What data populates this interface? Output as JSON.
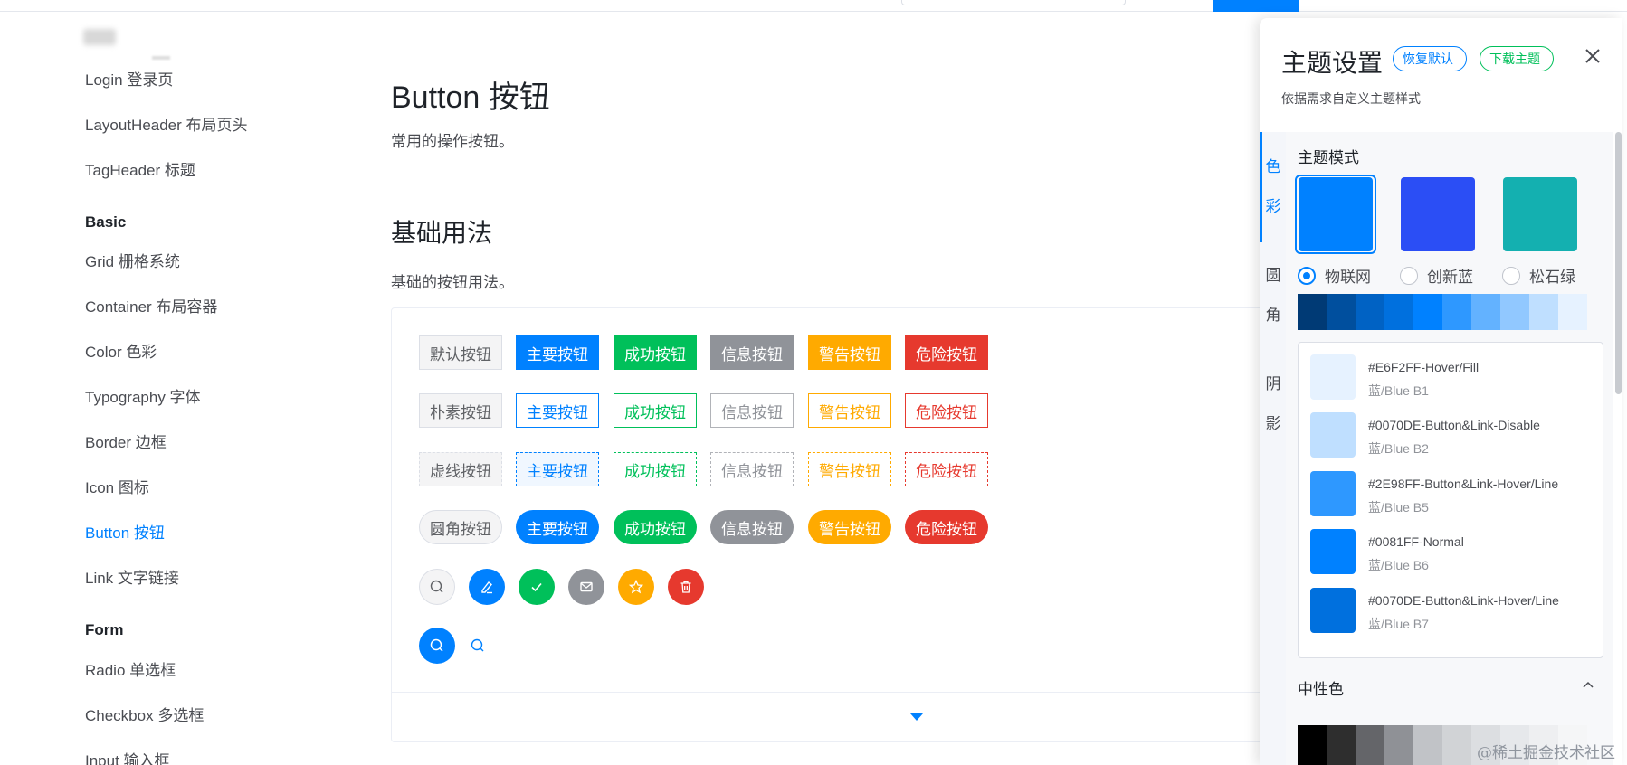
{
  "sidebar": {
    "items_top": [
      {
        "label": "Login 登录页"
      },
      {
        "label": "LayoutHeader 布局页头"
      },
      {
        "label": "TagHeader 标题"
      }
    ],
    "group_basic": "Basic",
    "items_basic": [
      {
        "label": "Grid 栅格系统"
      },
      {
        "label": "Container 布局容器"
      },
      {
        "label": "Color 色彩"
      },
      {
        "label": "Typography 字体"
      },
      {
        "label": "Border 边框"
      },
      {
        "label": "Icon 图标"
      },
      {
        "label": "Button 按钮",
        "active": true
      },
      {
        "label": "Link 文字链接"
      }
    ],
    "group_form": "Form",
    "items_form": [
      {
        "label": "Radio 单选框"
      },
      {
        "label": "Checkbox 多选框"
      },
      {
        "label": "Input 输入框"
      }
    ]
  },
  "main": {
    "title": "Button 按钮",
    "description": "常用的操作按钮。",
    "section_title": "基础用法",
    "section_description": "基础的按钮用法。",
    "rows": {
      "solid": [
        "默认按钮",
        "主要按钮",
        "成功按钮",
        "信息按钮",
        "警告按钮",
        "危险按钮"
      ],
      "plain": [
        "朴素按钮",
        "主要按钮",
        "成功按钮",
        "信息按钮",
        "警告按钮",
        "危险按钮"
      ],
      "dashed": [
        "虚线按钮",
        "主要按钮",
        "成功按钮",
        "信息按钮",
        "警告按钮",
        "危险按钮"
      ],
      "round": [
        "圆角按钮",
        "主要按钮",
        "成功按钮",
        "信息按钮",
        "警告按钮",
        "危险按钮"
      ]
    },
    "icon_buttons": [
      "search-icon",
      "edit-icon",
      "check-icon",
      "mail-icon",
      "star-icon",
      "delete-icon"
    ],
    "icon_buttons_row2": [
      "search-icon",
      "search-icon"
    ]
  },
  "theme_panel": {
    "title": "主题设置",
    "reset_label": "恢复默认",
    "download_label": "下载主题",
    "subtitle": "依据需求自定义主题样式",
    "tabs": [
      {
        "chars": [
          "色",
          "彩"
        ],
        "active": true
      },
      {
        "chars": [
          "圆",
          "角"
        ],
        "active": false
      },
      {
        "chars": [
          "阴",
          "影"
        ],
        "active": false
      }
    ],
    "mode_label": "主题模式",
    "modes": [
      {
        "label": "物联网",
        "color": "#0081ff",
        "selected": true
      },
      {
        "label": "创新蓝",
        "color": "#2b4ef5",
        "selected": false
      },
      {
        "label": "松石绿",
        "color": "#14b0b0",
        "selected": false
      }
    ],
    "palette": [
      "#003a75",
      "#004f9e",
      "#0062c4",
      "#0070de",
      "#0081ff",
      "#2e98ff",
      "#63b2ff",
      "#91c8ff",
      "#bfdfff",
      "#e6f2ff"
    ],
    "colors": [
      {
        "name": "#E6F2FF-Hover/Fill",
        "sub": "蓝/Blue B1",
        "color": "#e6f2ff"
      },
      {
        "name": "#0070DE-Button&Link-Disable",
        "sub": "蓝/Blue B2",
        "color": "#bfdfff"
      },
      {
        "name": "#2E98FF-Button&Link-Hover/Line",
        "sub": "蓝/Blue B5",
        "color": "#2e98ff"
      },
      {
        "name": "#0081FF-Normal",
        "sub": "蓝/Blue B6",
        "color": "#0081ff"
      },
      {
        "name": "#0070DE-Button&Link-Hover/Line",
        "sub": "蓝/Blue B7",
        "color": "#0070de"
      }
    ],
    "neutral_label": "中性色",
    "neutral_palette": [
      "#000000",
      "#2e2e2e",
      "#646569",
      "#8f9196",
      "#c1c3c7",
      "#d1d3d6",
      "#dcdee1",
      "#e6e8eb",
      "#eeeff1",
      "#f5f6f7"
    ]
  },
  "watermark": "@稀土掘金技术社区"
}
